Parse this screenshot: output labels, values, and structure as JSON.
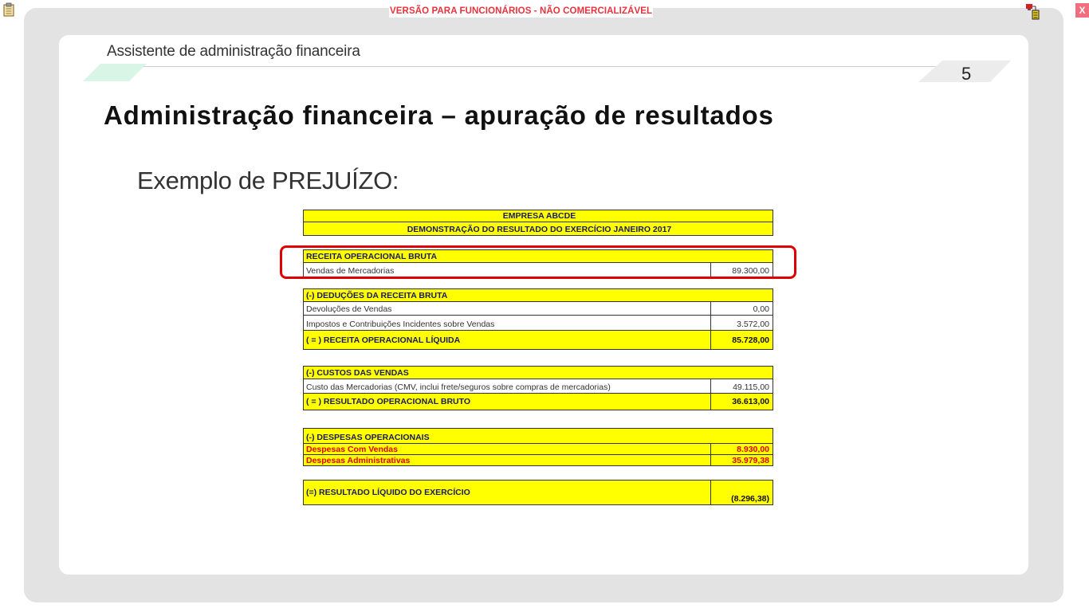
{
  "window": {
    "banner": "VERSÃO PARA FUNCIONÁRIOS - NÃO COMERCIALIZÁVEL",
    "close_label": "X"
  },
  "slide": {
    "subtitle": "Assistente de administração financeira",
    "page_number": "5",
    "title": "Administração financeira – apuração de resultados",
    "example_label": "Exemplo de PREJUÍZO:"
  },
  "statement": {
    "company": "EMPRESA ABCDE",
    "report_title": "DEMONSTRAÇÃO DO RESULTADO DO EXERCÍCIO JANEIRO 2017",
    "rows": [
      {
        "label": "RECEITA OPERACIONAL BRUTA",
        "value": ""
      },
      {
        "label": "Vendas de Mercadorias",
        "value": "89.300,00"
      },
      {
        "label": "(-) DEDUÇÕES DA RECEITA BRUTA",
        "value": ""
      },
      {
        "label": "Devoluções de Vendas",
        "value": "0,00"
      },
      {
        "label": "Impostos e Contribuições Incidentes sobre Vendas",
        "value": "3.572,00"
      },
      {
        "label": "( = ) RECEITA OPERACIONAL LÍQUIDA",
        "value": "85.728,00"
      },
      {
        "label": "(-) CUSTOS DAS VENDAS",
        "value": ""
      },
      {
        "label": "Custo das Mercadorias  (CMV, inclui frete/seguros sobre compras de mercadorias)",
        "value": "49.115,00"
      },
      {
        "label": "( = ) RESULTADO OPERACIONAL BRUTO",
        "value": "36.613,00"
      },
      {
        "label": "(-) DESPESAS OPERACIONAIS",
        "value": ""
      },
      {
        "label": "Despesas Com Vendas",
        "value": "8.930,00"
      },
      {
        "label": "Despesas Administrativas",
        "value": "35.979,38"
      },
      {
        "label": "(=) RESULTADO LÍQUIDO DO EXERCÍCIO",
        "value": "(8.296,38)"
      }
    ]
  },
  "colors": {
    "banner_text": "#e8323c",
    "close_bg": "#f26d7d",
    "highlight": "#ffff00",
    "box_outline": "#e00000",
    "header_text": "#1a1a5e"
  },
  "icons": [
    "clipboard-icon",
    "network-status-icon"
  ]
}
